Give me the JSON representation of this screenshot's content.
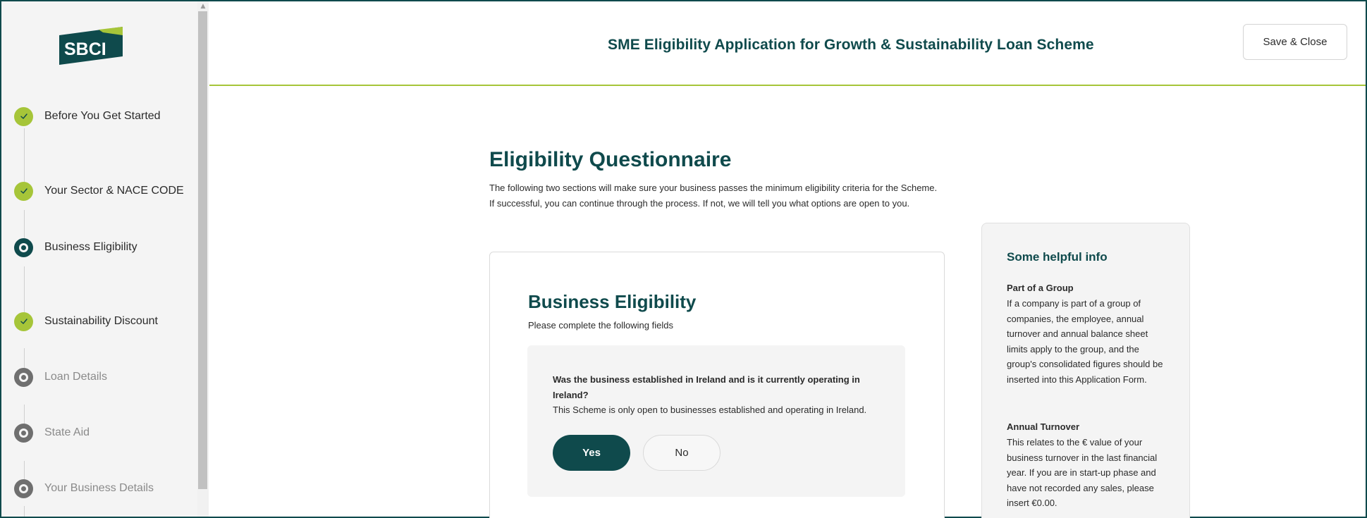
{
  "logo": {
    "text": "SBCI"
  },
  "steps": [
    {
      "label": "Before You Get Started",
      "state": "done"
    },
    {
      "label": "Your Sector & NACE CODE",
      "state": "done"
    },
    {
      "label": "Business Eligibility",
      "state": "current"
    },
    {
      "label": "Sustainability Discount",
      "state": "done"
    },
    {
      "label": "Loan Details",
      "state": "todo"
    },
    {
      "label": "State Aid",
      "state": "todo"
    },
    {
      "label": "Your Business Details",
      "state": "todo"
    }
  ],
  "header": {
    "title": "SME Eligibility Application for Growth & Sustainability Loan Scheme",
    "save_label": "Save & Close"
  },
  "questionnaire": {
    "title": "Eligibility Questionnaire",
    "desc_line1": "The following two sections will make sure your business passes the minimum eligibility criteria for the Scheme.",
    "desc_line2": "If successful, you can continue through the process. If not, we will tell you what options are open to you."
  },
  "card": {
    "title": "Business Eligibility",
    "subtitle": "Please complete the following fields",
    "question": "Was the business established in Ireland and is it currently operating in Ireland?",
    "help": "This Scheme is only open to businesses established and operating in Ireland.",
    "yes_label": "Yes",
    "no_label": "No",
    "selected": "Yes"
  },
  "info": {
    "title": "Some helpful info",
    "section1_heading": "Part of a Group",
    "section1_text": "If a company is part of a group of companies, the employee, annual turnover and annual balance sheet limits apply to the group, and the group's consolidated figures should be inserted into this Application Form.",
    "section2_heading": "Annual Turnover",
    "section2_text": "This relates to the € value of your business turnover in the last financial year. If you are in start-up phase and have not recorded any sales, please insert €0.00."
  },
  "colors": {
    "brand_dark": "#0f4a4c",
    "brand_green": "#a6c539",
    "muted_grey": "#6f6f6f"
  }
}
